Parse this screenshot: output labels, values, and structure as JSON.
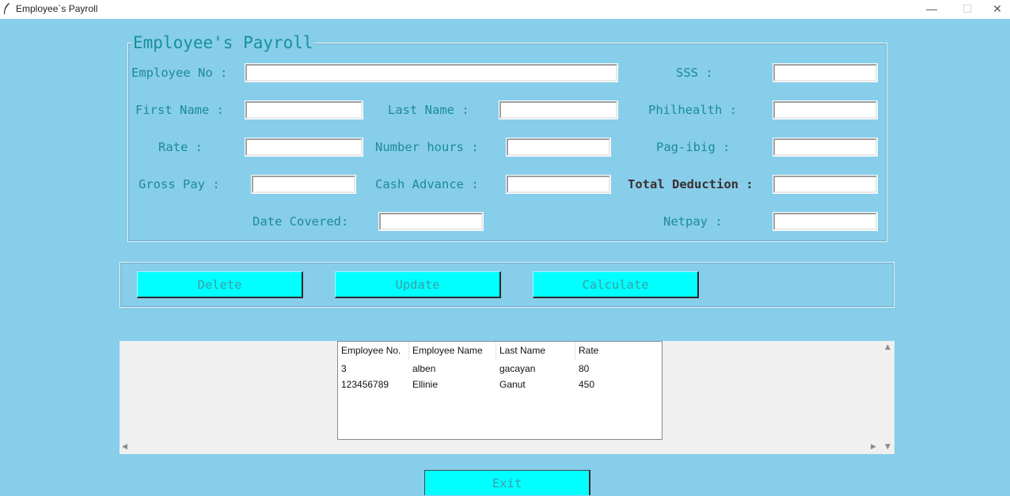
{
  "window": {
    "title": "Employee`s Payroll",
    "icon": "feather-icon",
    "controls": {
      "minimize": "—",
      "maximize": "☐",
      "close": "✕"
    }
  },
  "form": {
    "legend": "Employee's Payroll",
    "employee_no_label": "Employee No :",
    "sss_label": "SSS :",
    "first_name_label": "First Name :",
    "last_name_label": "Last Name :",
    "philhealth_label": "Philhealth :",
    "rate_label": "Rate :",
    "number_hours_label": "Number hours :",
    "pagibig_label": "Pag-ibig :",
    "gross_pay_label": "Gross Pay :",
    "cash_advance_label": "Cash Advance :",
    "total_deduction_label": "Total Deduction :",
    "date_covered_label": "Date Covered:",
    "netpay_label": "Netpay :",
    "values": {
      "employee_no": "",
      "sss": "",
      "first_name": "",
      "last_name": "",
      "philhealth": "",
      "rate": "",
      "number_hours": "",
      "pagibig": "",
      "gross_pay": "",
      "cash_advance": "",
      "total_deduction": "",
      "date_covered": "",
      "netpay": ""
    }
  },
  "buttons": {
    "delete": "Delete",
    "update": "Update",
    "calculate": "Calculate",
    "exit": "Exit"
  },
  "table": {
    "columns": [
      "Employee No.",
      "Employee Name",
      "Last Name",
      "Rate"
    ],
    "rows": [
      [
        "3",
        "alben",
        "gacayan",
        "80"
      ],
      [
        "123456789",
        "Ellinie",
        "Ganut",
        "450"
      ]
    ]
  },
  "colors": {
    "background": "#87ceeb",
    "button": "#00ffff",
    "label_text": "#1a8b99"
  }
}
